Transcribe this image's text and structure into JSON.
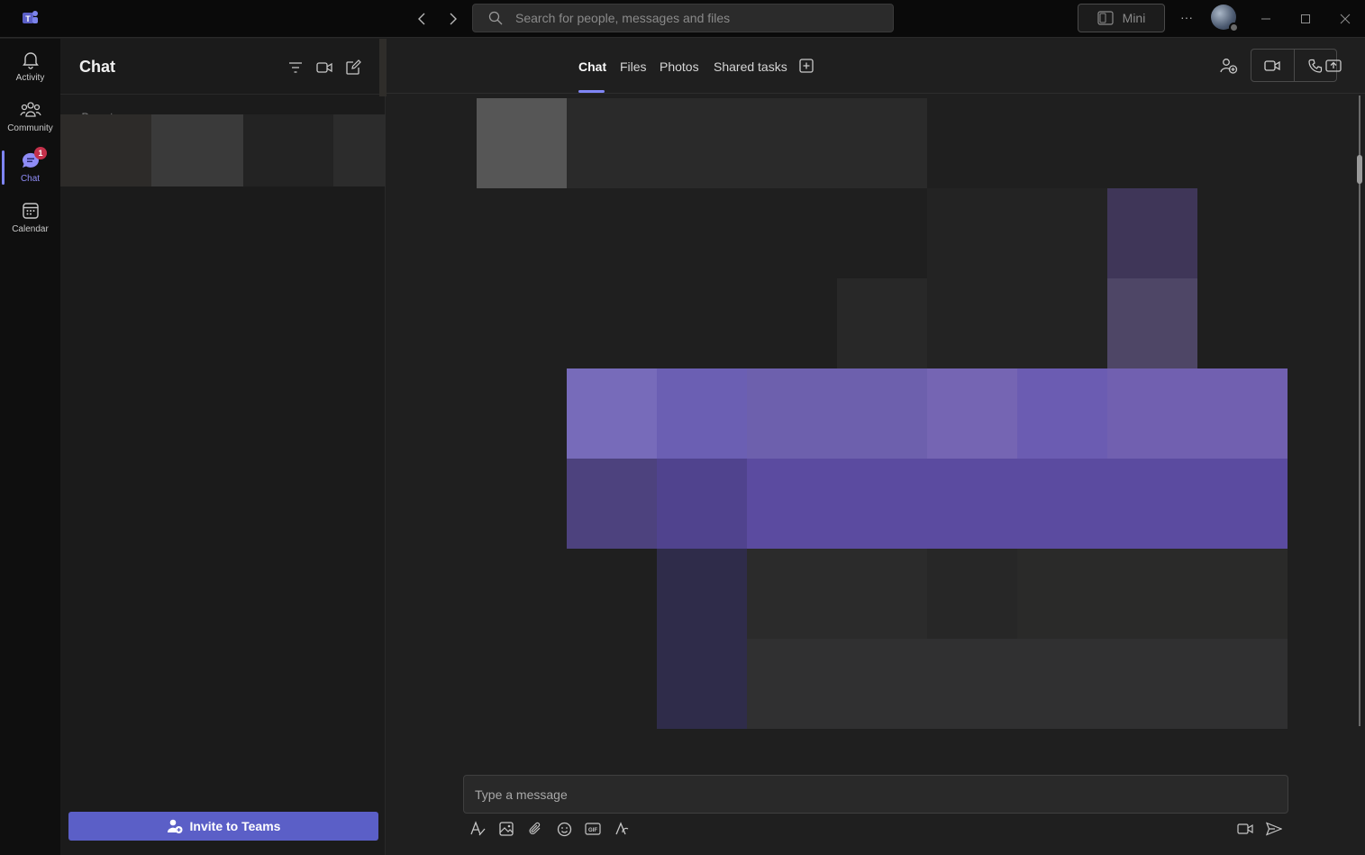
{
  "titlebar": {
    "search_placeholder": "Search for people, messages and files",
    "mini_label": "Mini",
    "more_icon": "more-horizontal-icon"
  },
  "rail": {
    "items": [
      {
        "label": "Activity",
        "icon": "bell-icon"
      },
      {
        "label": "Community",
        "icon": "community-icon"
      },
      {
        "label": "Chat",
        "icon": "chat-icon",
        "badge": "1",
        "active": true
      },
      {
        "label": "Calendar",
        "icon": "calendar-icon"
      }
    ]
  },
  "list": {
    "title": "Chat",
    "recent_label": "Recent",
    "invite_label": "Invite to Teams"
  },
  "main": {
    "tabs": [
      {
        "label": "Chat",
        "active": true
      },
      {
        "label": "Files"
      },
      {
        "label": "Photos"
      },
      {
        "label": "Shared tasks"
      }
    ],
    "composer_placeholder": "Type a message"
  },
  "colors": {
    "accent": "#5b5fc7",
    "accent_light": "#7f85f5",
    "badge": "#c4314b"
  }
}
